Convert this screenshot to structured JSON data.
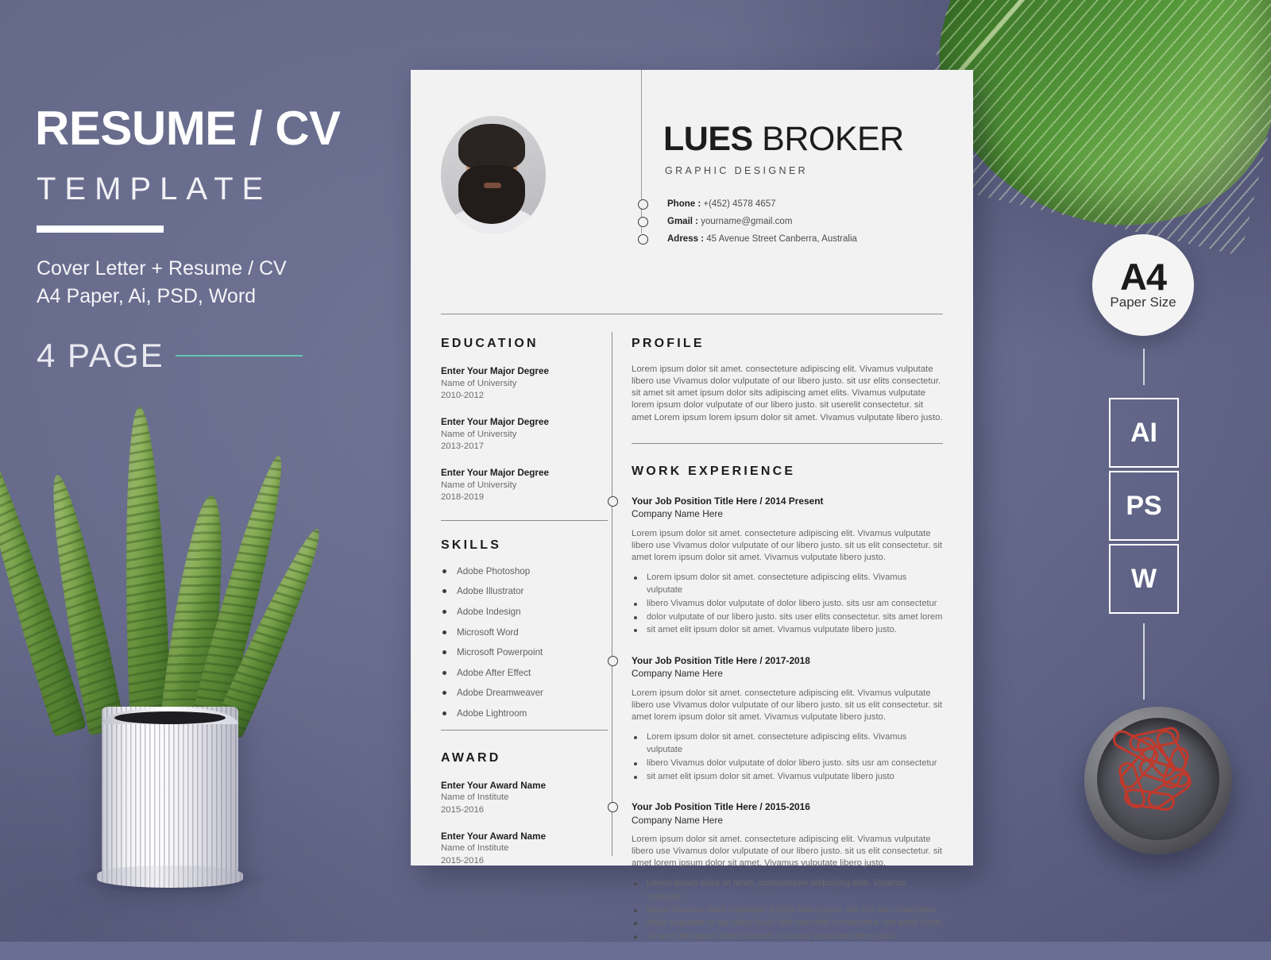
{
  "promo": {
    "title": "RESUME / CV",
    "subtitle": "TEMPLATE",
    "line1": "Cover Letter + Resume / CV",
    "line2": "A4 Paper, Ai, PSD, Word",
    "pages": "4 PAGE",
    "accent_color": "#66c5b0",
    "background_color": "#6a6e92"
  },
  "resume": {
    "name_first": "LUES",
    "name_last": "BROKER",
    "role": "GRAPHIC DESIGNER",
    "contacts": [
      {
        "label": "Phone :",
        "value": "+(452) 4578 4657"
      },
      {
        "label": "Gmail :",
        "value": "yourname@gmail.com"
      },
      {
        "label": "Adress :",
        "value": "45 Avenue Street Canberra, Australia"
      }
    ],
    "education": {
      "heading": "EDUCATION",
      "items": [
        {
          "title": "Enter Your Major Degree",
          "school": "Name of University",
          "dates": "2010-2012"
        },
        {
          "title": "Enter Your Major Degree",
          "school": "Name of University",
          "dates": "2013-2017"
        },
        {
          "title": "Enter Your Major Degree",
          "school": "Name of University",
          "dates": "2018-2019"
        }
      ]
    },
    "skills": {
      "heading": "SKILLS",
      "items": [
        "Adobe Photoshop",
        "Adobe Illustrator",
        "Adobe Indesign",
        "Microsoft Word",
        "Microsoft Powerpoint",
        "Adobe After Effect",
        "Adobe Dreamweaver",
        "Adobe Lightroom"
      ]
    },
    "award": {
      "heading": "AWARD",
      "items": [
        {
          "title": "Enter Your Award Name",
          "school": "Name of Institute",
          "dates": "2015-2016"
        },
        {
          "title": "Enter Your Award Name",
          "school": "Name of Institute",
          "dates": "2015-2016"
        }
      ]
    },
    "profile": {
      "heading": "PROFILE",
      "body": "Lorem ipsum dolor sit amet. consecteture adipiscing elit. Vivamus vulputate libero use  Vivamus dolor vulputate of our libero justo. sit usr elits consectetur. sit amet sit amet ipsum dolor sits adipiscing amet elits. Vivamus vulputate lorem ipsum dolor vulputate of our libero justo. sit userelit consectetur. sit amet Lorem ipsum lorem ipsum dolor sit amet. Vivamus vulputate libero justo."
    },
    "work": {
      "heading": "WORK EXPERIENCE",
      "jobs": [
        {
          "title": "Your Job Position Title Here / 2014 Present",
          "company": "Company Name Here",
          "body": "Lorem ipsum dolor sit amet. consecteture adipiscing elit. Vivamus vulputate libero use  Vivamus dolor vulputate of our libero justo. sit us elit consectetur. sit amet lorem ipsum dolor sit amet. Vivamus vulputate libero justo.",
          "bullets": [
            "Lorem ipsum dolor sit amet. consecteture adipiscing elits. Vivamus vulputate",
            "libero Vivamus dolor vulputate of dolor libero justo. sits usr am consectetur",
            "dolor vulputate of our libero justo. sits user elits consectetur. sits amet lorem",
            "sit amet elit ipsum dolor sit amet. Vivamus vulputate libero justo."
          ]
        },
        {
          "title": "Your Job Position Title Here / 2017-2018",
          "company": "Company Name Here",
          "body": "Lorem ipsum dolor sit amet. consecteture adipiscing elit. Vivamus vulputate libero use  Vivamus dolor vulputate of our libero justo. sit us elit consectetur. sit amet lorem ipsum dolor sit amet. Vivamus vulputate libero justo.",
          "bullets": [
            "Lorem ipsum dolor sit amet. consecteture adipiscing elits. Vivamus vulputate",
            "libero Vivamus dolor vulputate of dolor libero justo. sits usr am consectetur",
            "sit amet elit ipsum dolor sit amet. Vivamus vulputate libero justo"
          ]
        },
        {
          "title": "Your Job Position Title Here / 2015-2016",
          "company": "Company Name Here",
          "body": "Lorem ipsum dolor sit amet. consecteture adipiscing elit. Vivamus vulputate libero use  Vivamus dolor vulputate of our libero justo. sit us elit consectetur. sit amet lorem ipsum dolor sit amet. Vivamus vulputate libero justo.",
          "bullets": [
            "Lorem ipsum dolor sit amet. consecteture adipiscing elits. Vivamus vulputate",
            "libero Vivamus dolor vulputate of dolor libero justo. sits usr am consectetur",
            "dolor vulputate of our libero justo. sits user elits consectetur. sits amet lorem",
            "sit amet elit ipsum dolor sit amet. Vivamus vulputate libero justo."
          ]
        }
      ]
    }
  },
  "rail": {
    "paper_size_big": "A4",
    "paper_size_small": "Paper Size",
    "formats": [
      "AI",
      "PS",
      "W"
    ]
  }
}
